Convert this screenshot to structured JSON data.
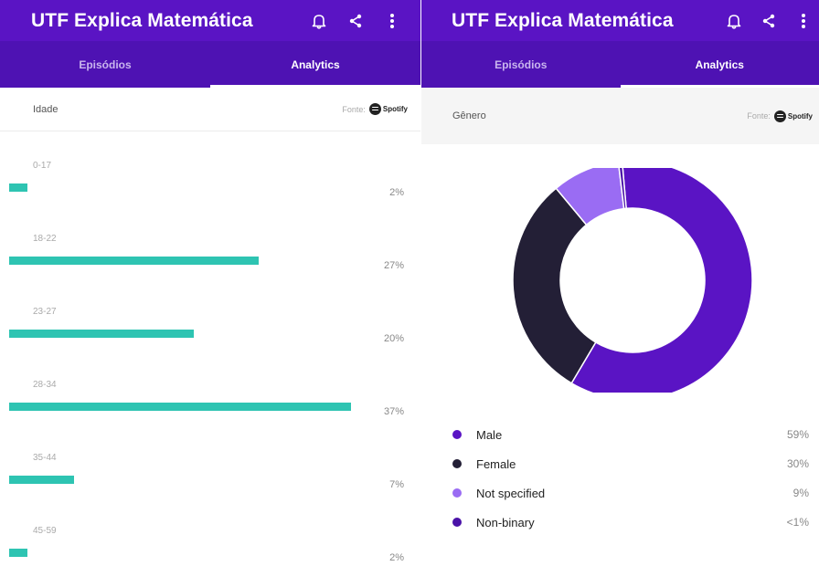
{
  "left": {
    "appbar": {
      "title": "UTF Explica Matemática"
    },
    "tabs": [
      {
        "label": "Episódios",
        "active": false
      },
      {
        "label": "Analytics",
        "active": true
      }
    ],
    "section": {
      "title": "Idade",
      "source_label": "Fonte:",
      "source_name": "Spotify"
    },
    "age_groups": [
      {
        "label": "0-17",
        "value": 2,
        "pct_label": "2%"
      },
      {
        "label": "18-22",
        "value": 27,
        "pct_label": "27%"
      },
      {
        "label": "23-27",
        "value": 20,
        "pct_label": "20%"
      },
      {
        "label": "28-34",
        "value": 37,
        "pct_label": "37%"
      },
      {
        "label": "35-44",
        "value": 7,
        "pct_label": "7%"
      },
      {
        "label": "45-59",
        "value": 2,
        "pct_label": "2%"
      }
    ]
  },
  "right": {
    "appbar": {
      "title": "UTF Explica Matemática"
    },
    "tabs": [
      {
        "label": "Episódios",
        "active": false
      },
      {
        "label": "Analytics",
        "active": true
      }
    ],
    "section": {
      "title": "Gênero",
      "source_label": "Fonte:",
      "source_name": "Spotify"
    },
    "gender_legend": [
      {
        "label": "Male",
        "pct_label": "59%",
        "color": "#5a14c4"
      },
      {
        "label": "Female",
        "pct_label": "30%",
        "color": "#231f36"
      },
      {
        "label": "Not specified",
        "pct_label": "9%",
        "color": "#9a6cf3"
      },
      {
        "label": "Non-binary",
        "pct_label": "<1%",
        "color": "#4a12a8"
      }
    ]
  },
  "colors": {
    "appbar": "#5a14c4",
    "tabs": "#4e12b3",
    "age_bar": "#2ec4b2"
  },
  "chart_data": [
    {
      "type": "bar",
      "categories": [
        "0-17",
        "18-22",
        "23-27",
        "28-34",
        "35-44",
        "45-59"
      ],
      "values": [
        2,
        27,
        20,
        37,
        7,
        2
      ],
      "title": "Idade"
    },
    {
      "type": "pie",
      "categories": [
        "Male",
        "Female",
        "Not specified",
        "Non-binary"
      ],
      "values": [
        59,
        30,
        9,
        0.5
      ],
      "colors": [
        "#5a14c4",
        "#231f36",
        "#9a6cf3",
        "#4a12a8"
      ],
      "title": "Gênero"
    }
  ]
}
